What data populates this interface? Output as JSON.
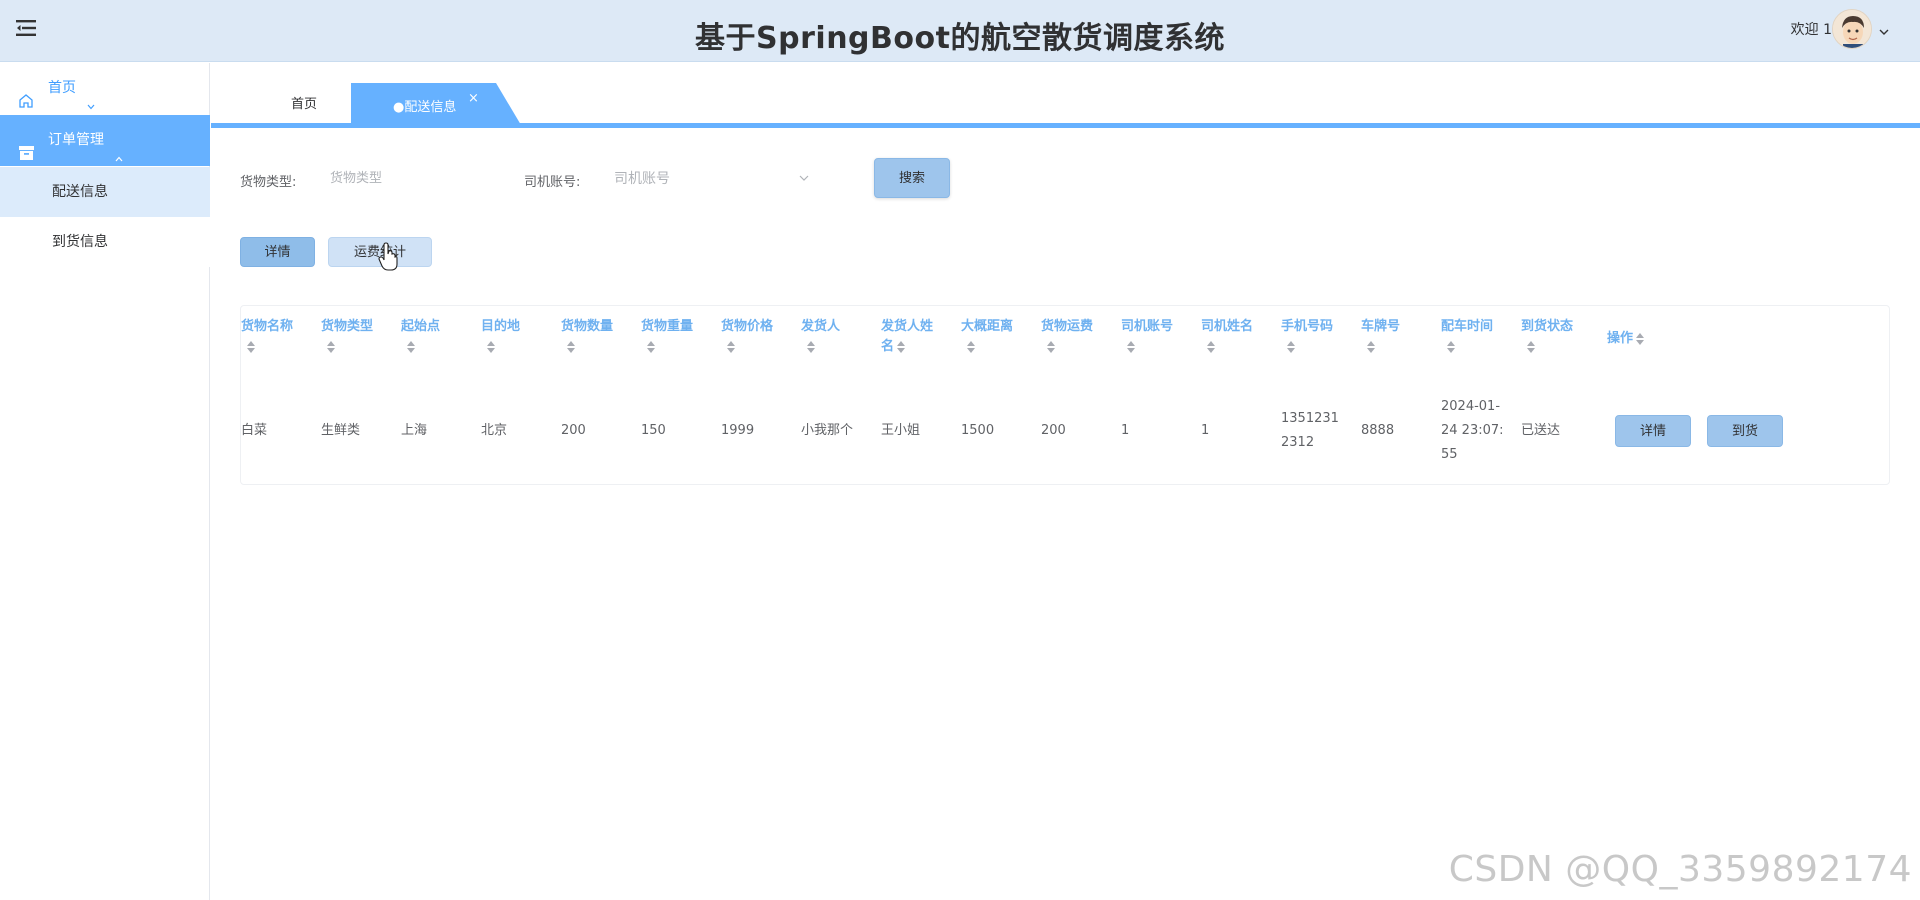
{
  "header": {
    "title": "基于SpringBoot的航空散货调度系统",
    "welcome": "欢迎 1"
  },
  "sidebar": {
    "home": "首页",
    "order_menu": "订单管理",
    "sub_items": [
      "配送信息",
      "到货信息"
    ]
  },
  "tabs": {
    "home": "首页",
    "active": "●配送信息",
    "close": "×"
  },
  "filters": {
    "cargo_type_label": "货物类型:",
    "cargo_type_placeholder": "货物类型",
    "driver_account_label": "司机账号:",
    "driver_account_placeholder": "司机账号",
    "search_button": "搜索"
  },
  "toolbar": {
    "detail_button": "详情",
    "stats_button": "运费统计"
  },
  "table": {
    "columns": [
      [
        "货物名称"
      ],
      [
        "货物类型"
      ],
      [
        "起始点"
      ],
      [
        "目的地"
      ],
      [
        "货物数量"
      ],
      [
        "货物重量"
      ],
      [
        "货物价格"
      ],
      [
        "发货人"
      ],
      [
        "发货人姓",
        "名"
      ],
      [
        "大概距离"
      ],
      [
        "货物运费"
      ],
      [
        "司机账号"
      ],
      [
        "司机姓名"
      ],
      [
        "手机号码"
      ],
      [
        "车牌号"
      ],
      [
        "配车时间"
      ],
      [
        "到货状态"
      ],
      [
        "操作"
      ]
    ],
    "rows": [
      {
        "cells": [
          [
            "白菜"
          ],
          [
            "生鲜类"
          ],
          [
            "上海"
          ],
          [
            "北京"
          ],
          [
            "200"
          ],
          [
            "150"
          ],
          [
            "1999"
          ],
          [
            "小我那个"
          ],
          [
            "王小姐"
          ],
          [
            "1500"
          ],
          [
            "200"
          ],
          [
            "1"
          ],
          [
            "1"
          ],
          [
            "1351231",
            "2312"
          ],
          [
            "8888"
          ],
          [
            "2024-01-",
            "24 23:07:",
            "55"
          ],
          [
            "已送达"
          ]
        ],
        "actions": [
          "详情",
          "到货"
        ]
      }
    ]
  },
  "watermark": "CSDN @QQ_3359892174"
}
